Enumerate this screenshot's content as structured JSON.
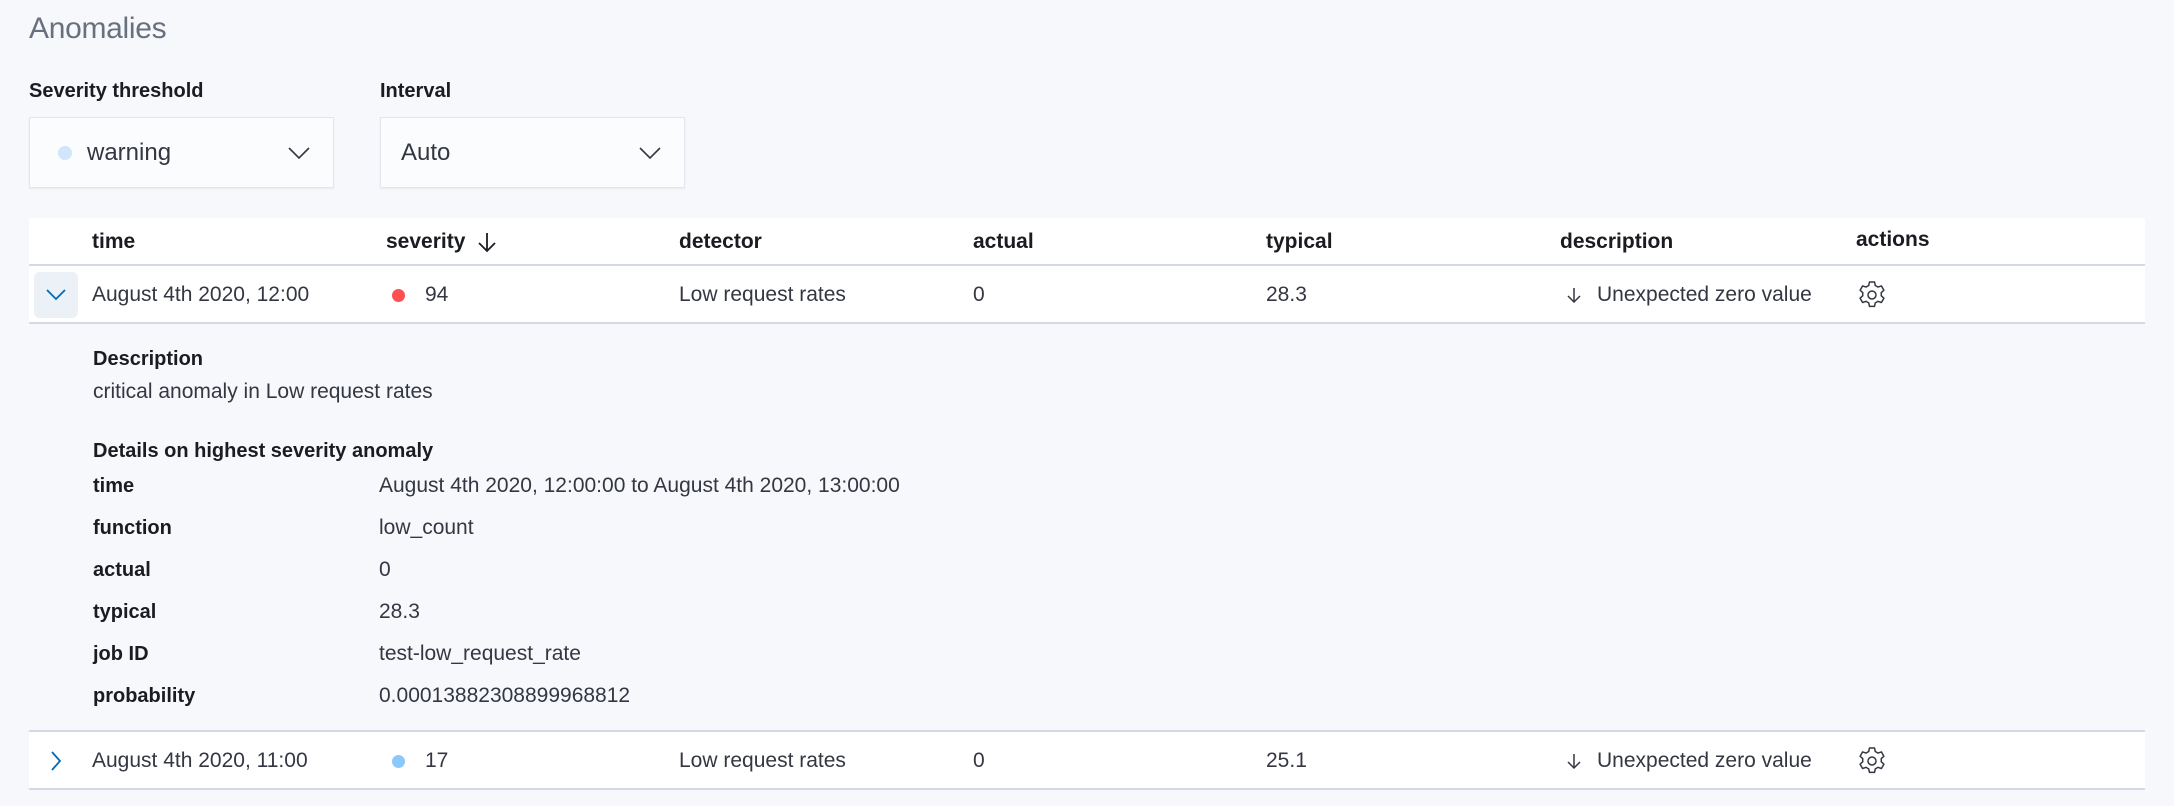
{
  "page": {
    "title": "Anomalies"
  },
  "controls": {
    "severity_threshold": {
      "label": "Severity threshold",
      "value": "warning",
      "dot_color": "#d1e6fa"
    },
    "interval": {
      "label": "Interval",
      "value": "Auto"
    }
  },
  "table": {
    "columns": {
      "time": "time",
      "severity": "severity",
      "detector": "detector",
      "actual": "actual",
      "typical": "typical",
      "description": "description",
      "actions": "actions"
    },
    "sort": {
      "column": "severity",
      "direction": "descending",
      "icon": "arrow-down-icon"
    },
    "rows": [
      {
        "expanded": true,
        "time": "August 4th 2020, 12:00",
        "severity": "94",
        "severity_color": "#fe5050",
        "detector": "Low request rates",
        "actual": "0",
        "typical": "28.3",
        "description": "Unexpected zero value",
        "description_icon": "arrow-down-icon",
        "action_icon": "gear-icon"
      },
      {
        "expanded": false,
        "time": "August 4th 2020, 11:00",
        "severity": "17",
        "severity_color": "#8bc8fb",
        "detector": "Low request rates",
        "actual": "0",
        "typical": "25.1",
        "description": "Unexpected zero value",
        "description_icon": "arrow-down-icon",
        "action_icon": "gear-icon"
      }
    ],
    "expanded_details": {
      "description_heading": "Description",
      "description_text": "critical anomaly in Low request rates",
      "details_heading": "Details on highest severity anomaly",
      "fields": [
        {
          "label": "time",
          "value": "August 4th 2020, 12:00:00 to August 4th 2020, 13:00:00"
        },
        {
          "label": "function",
          "value": "low_count"
        },
        {
          "label": "actual",
          "value": "0"
        },
        {
          "label": "typical",
          "value": "28.3"
        },
        {
          "label": "job ID",
          "value": "test-low_request_rate"
        },
        {
          "label": "probability",
          "value": "0.00013882308899968812"
        }
      ]
    }
  }
}
